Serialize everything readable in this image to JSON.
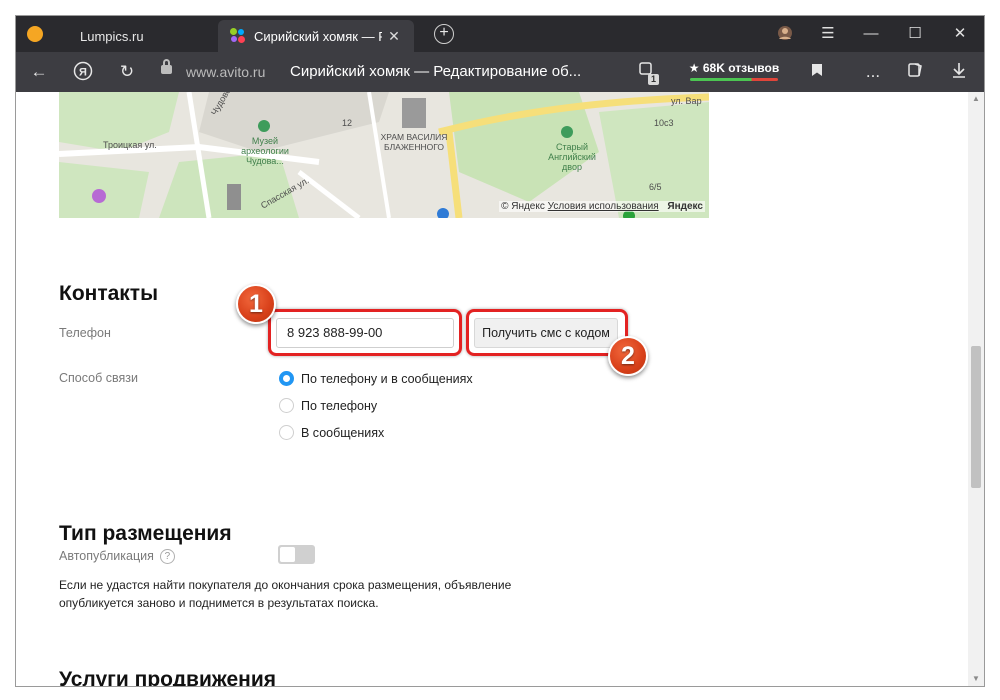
{
  "browser": {
    "tabs": [
      {
        "label": "Lumpics.ru",
        "active": false
      },
      {
        "label": "Сирийский хомяк — Ре",
        "active": true
      }
    ],
    "url_domain": "www.avito.ru",
    "page_title": "Сирийский хомяк — Редактирование об...",
    "reviews_label": "★ 68K отзывов",
    "tab_counter": "1",
    "icons": {
      "back": "arrow-left-icon",
      "yandex": "yandex-icon",
      "reload": "reload-icon",
      "lock": "lock-icon",
      "bookmark": "bookmark-icon",
      "more": "more-icon",
      "downloads": "download-icon"
    },
    "menu_more": "..."
  },
  "map": {
    "labels": {
      "street_troitskaya": "Троицкая ул.",
      "street_chudovskaya": "Чудовская ул.",
      "street_spasskaya": "Спасская ул.",
      "street_var": "ул. Вар",
      "museum": "Музей археологии Чудова...",
      "cathedral": "ХРАМ ВАСИЛИЯ БЛАЖЕННОГО",
      "english_court": "Старый Английский двор",
      "num_12": "12",
      "num_10c3": "10с3",
      "num_6_5": "6/5"
    },
    "copyright": "© Яндекс",
    "terms": "Условия использования",
    "brand": "Яндекс"
  },
  "contacts": {
    "heading": "Контакты",
    "phone_label": "Телефон",
    "phone_value": "8 923 888-99-00",
    "sms_button": "Получить смс с кодом",
    "method_label": "Способ связи",
    "options": [
      {
        "label": "По телефону и в сообщениях",
        "selected": true
      },
      {
        "label": "По телефону",
        "selected": false
      },
      {
        "label": "В сообщениях",
        "selected": false
      }
    ]
  },
  "placement": {
    "heading": "Тип размещения",
    "autopub_label": "Автопубликация",
    "help": "?",
    "autopub_enabled": false,
    "description": "Если не удастся найти покупателя до окончания срока размещения, объявление опубликуется заново и поднимется в результатах поиска."
  },
  "promotion": {
    "heading": "Услуги продвижения"
  },
  "annotations": {
    "marker1": "1",
    "marker2": "2",
    "highlight_color": "#e32222"
  },
  "colors": {
    "accent_radio": "#2196f3",
    "browser_dark": "#2a2a2e",
    "browser_toolbar": "#3d3d42"
  }
}
